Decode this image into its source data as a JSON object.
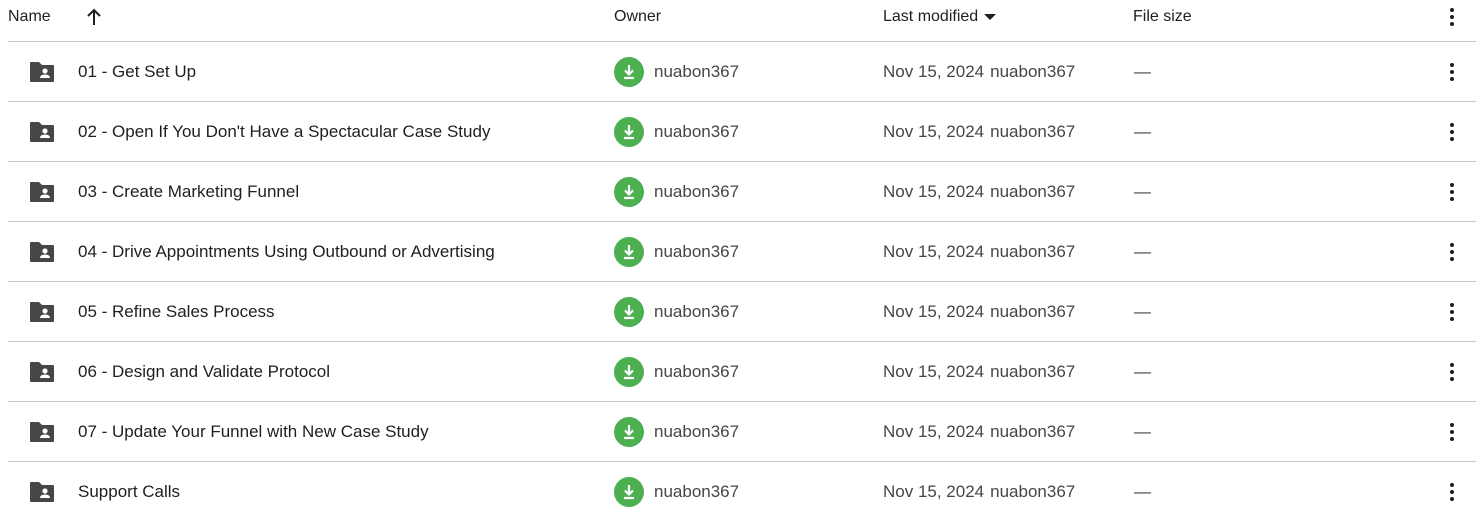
{
  "header": {
    "name": "Name",
    "sort_icon": "arrow-up-icon",
    "owner": "Owner",
    "last_modified": "Last modified",
    "last_modified_icon": "caret-down-icon",
    "file_size": "File size",
    "more_icon": "more-vert-icon"
  },
  "colors": {
    "owner_avatar": "#4caf50",
    "folder_icon": "#444746",
    "divider": "#c7c7c7"
  },
  "rows": [
    {
      "name": "01 - Get Set Up",
      "owner": "nuabon367",
      "modified_date": "Nov 15, 2024",
      "modified_by": "nuabon367",
      "file_size": "—"
    },
    {
      "name": "02 - Open If You Don't Have a Spectacular Case Study",
      "owner": "nuabon367",
      "modified_date": "Nov 15, 2024",
      "modified_by": "nuabon367",
      "file_size": "—"
    },
    {
      "name": "03 - Create Marketing Funnel",
      "owner": "nuabon367",
      "modified_date": "Nov 15, 2024",
      "modified_by": "nuabon367",
      "file_size": "—"
    },
    {
      "name": "04 - Drive Appointments Using Outbound or Advertising",
      "owner": "nuabon367",
      "modified_date": "Nov 15, 2024",
      "modified_by": "nuabon367",
      "file_size": "—"
    },
    {
      "name": "05 - Refine Sales Process",
      "owner": "nuabon367",
      "modified_date": "Nov 15, 2024",
      "modified_by": "nuabon367",
      "file_size": "—"
    },
    {
      "name": "06 - Design and Validate Protocol",
      "owner": "nuabon367",
      "modified_date": "Nov 15, 2024",
      "modified_by": "nuabon367",
      "file_size": "—"
    },
    {
      "name": "07 - Update Your Funnel with New Case Study",
      "owner": "nuabon367",
      "modified_date": "Nov 15, 2024",
      "modified_by": "nuabon367",
      "file_size": "—"
    },
    {
      "name": "Support Calls",
      "owner": "nuabon367",
      "modified_date": "Nov 15, 2024",
      "modified_by": "nuabon367",
      "file_size": "—"
    }
  ]
}
